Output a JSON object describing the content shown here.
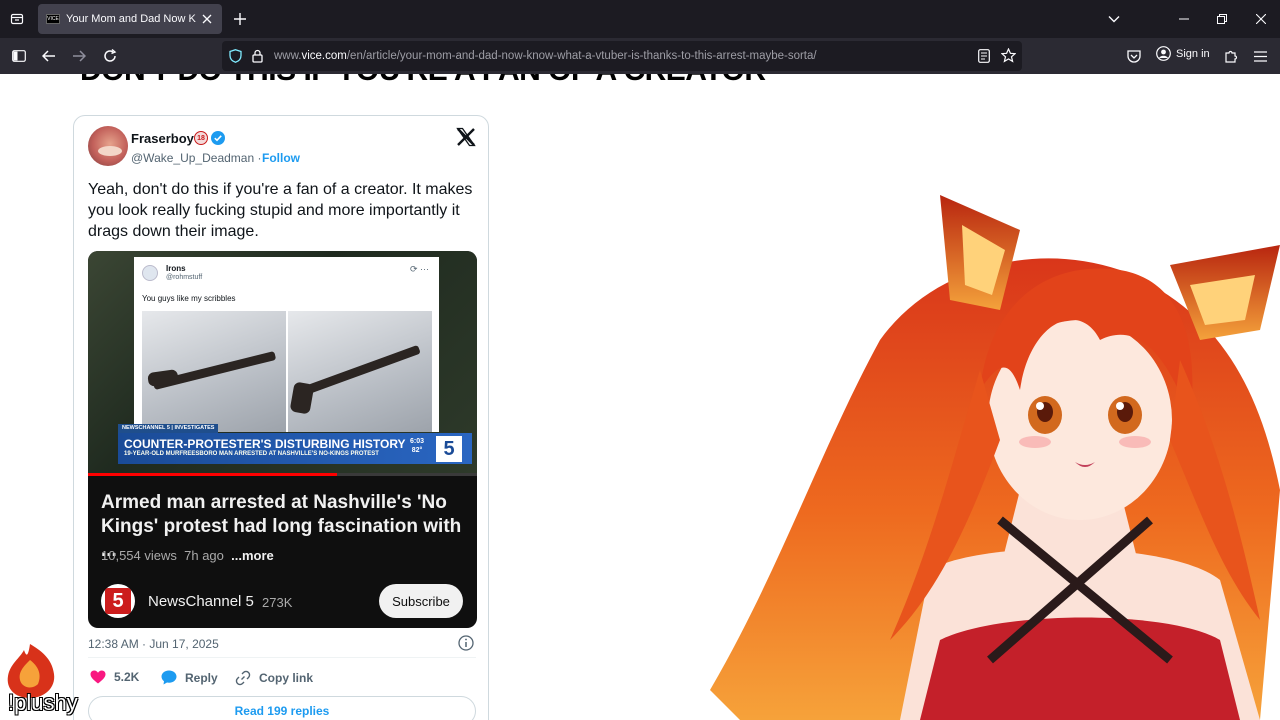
{
  "browser": {
    "tab": {
      "title": "Your Mom and Dad Now Know"
    },
    "url": {
      "prefix": "www.",
      "host": "vice.com",
      "path": "/en/article/your-mom-and-dad-now-know-what-a-vtuber-is-thanks-to-this-arrest-maybe-sorta/"
    },
    "sign_in_label": "Sign in"
  },
  "article": {
    "heading_partial": "DON'T DO THIS IF YOU'RE A FAN OF A CREATOR"
  },
  "tweet": {
    "author_name": "Fraserboy",
    "badge_text": "18",
    "handle": "@Wake_Up_Deadman",
    "follow_label": "Follow",
    "text": "Yeah, don't do this if you're a fan of a creator. It makes you look really fucking stupid and more importantly it drags down their image.",
    "timestamp": "12:38 AM · Jun 17, 2025",
    "likes": "5.2K",
    "reply_label": "Reply",
    "copy_link_label": "Copy link",
    "read_replies_label": "Read 199 replies",
    "embed": {
      "screenshot": {
        "name": "Irons",
        "handle": "@rohmstuff",
        "text": "You guys like my scribbles"
      },
      "chyron_tag": "NEWSCHANNEL 5 | INVESTIGATES",
      "chyron_main": "COUNTER-PROTESTER'S DISTURBING HISTORY",
      "chyron_sub": "19-YEAR-OLD MURFREESBORO MAN ARRESTED AT NASHVILLE'S NO-KINGS PROTEST",
      "chyron_time": "6:03",
      "chyron_temp": "82°",
      "chyron_logo": "5",
      "progress_fraction": 0.64,
      "title": "Armed man arrested at Nashville's 'No Kings' protest had long fascination with ...",
      "views": "10,554 views",
      "age": "7h ago",
      "more_label": "...more",
      "channel_logo": "5",
      "channel_name": "NewsChannel 5",
      "subscribers": "273K",
      "subscribe_label": "Subscribe"
    }
  },
  "overlay": {
    "plushy_label": "!plushy"
  },
  "colors": {
    "tab_bar": "#1c1b22",
    "nav_bar": "#2b2a33",
    "twitter_blue": "#1d9bf0",
    "like_pink": "#f91880",
    "youtube_dark": "#0f0f0f",
    "hair_orange": "#e8541c"
  }
}
